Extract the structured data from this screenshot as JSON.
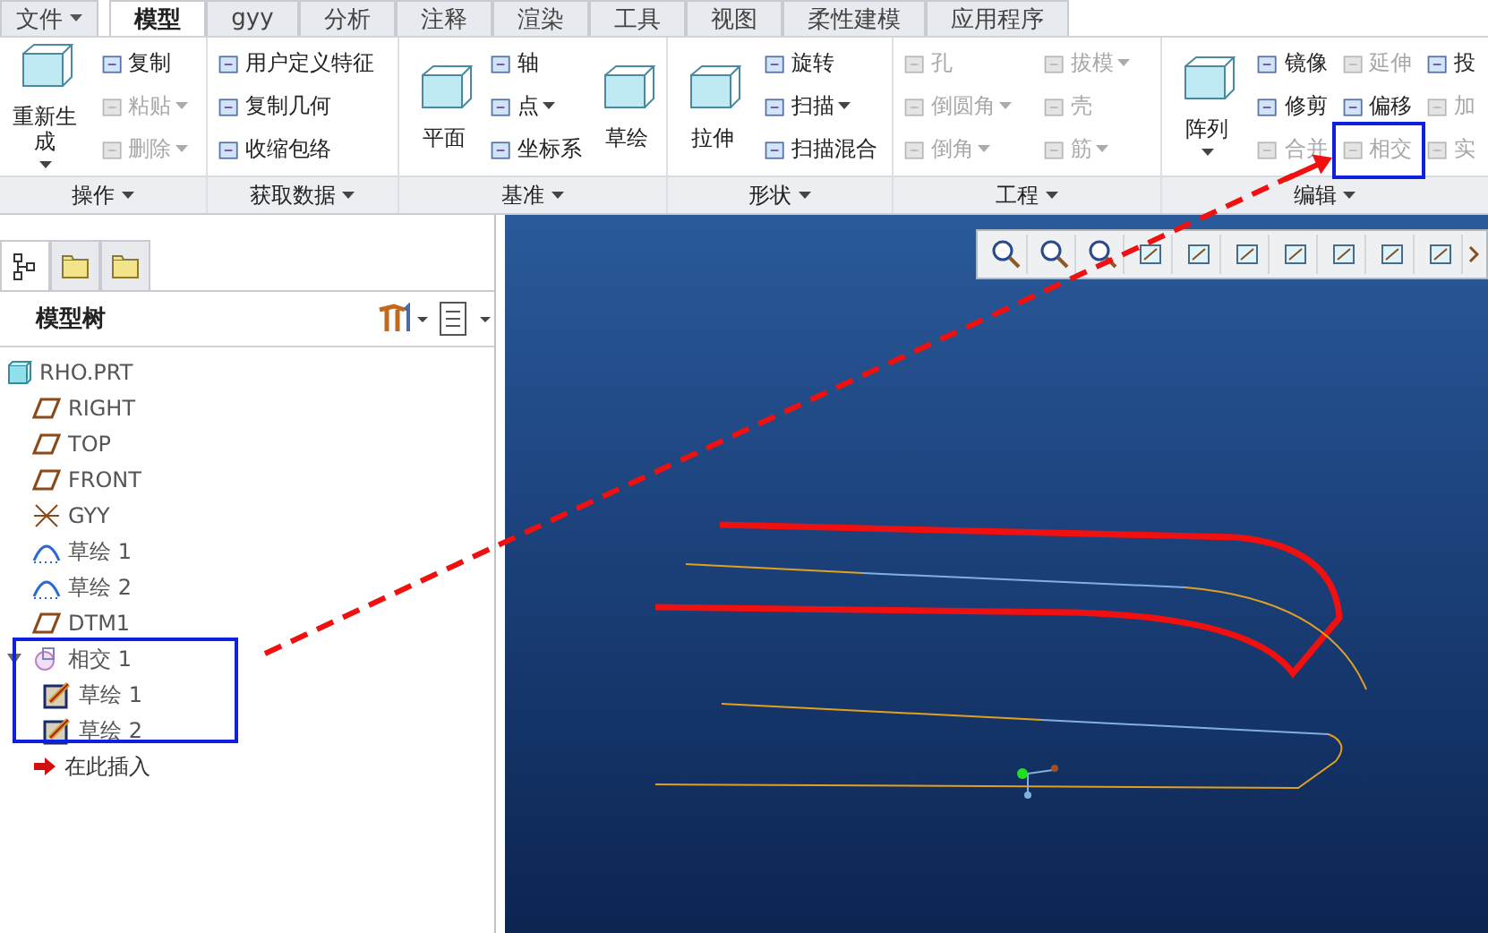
{
  "menu_tabs": [
    {
      "label": "文件",
      "kind": "file",
      "selected": false
    },
    {
      "label": "模型",
      "kind": "tab",
      "selected": true
    },
    {
      "label": "gyy",
      "kind": "tab",
      "selected": false
    },
    {
      "label": "分析",
      "kind": "tab",
      "selected": false
    },
    {
      "label": "注释",
      "kind": "tab",
      "selected": false
    },
    {
      "label": "渲染",
      "kind": "tab",
      "selected": false
    },
    {
      "label": "工具",
      "kind": "tab",
      "selected": false
    },
    {
      "label": "视图",
      "kind": "tab",
      "selected": false
    },
    {
      "label": "柔性建模",
      "kind": "tab",
      "selected": false
    },
    {
      "label": "应用程序",
      "kind": "tab",
      "selected": false
    }
  ],
  "ribbon_groups": [
    {
      "label": "操作",
      "items": [
        {
          "label": "重新生成",
          "kind": "large",
          "disabled": false,
          "dropdown": true
        },
        {
          "label": "复制",
          "kind": "small",
          "disabled": false,
          "dropdown": false
        },
        {
          "label": "粘贴",
          "kind": "small",
          "disabled": true,
          "dropdown": true
        },
        {
          "label": "删除",
          "kind": "small",
          "disabled": true,
          "dropdown": true
        }
      ]
    },
    {
      "label": "获取数据",
      "items": [
        {
          "label": "用户定义特征",
          "kind": "small",
          "disabled": false,
          "dropdown": false
        },
        {
          "label": "复制几何",
          "kind": "small",
          "disabled": false,
          "dropdown": false
        },
        {
          "label": "收缩包络",
          "kind": "small",
          "disabled": false,
          "dropdown": false
        }
      ]
    },
    {
      "label": "基准",
      "items": [
        {
          "label": "平面",
          "kind": "large",
          "disabled": false,
          "dropdown": false
        },
        {
          "label": "轴",
          "kind": "small",
          "disabled": false,
          "dropdown": false
        },
        {
          "label": "点",
          "kind": "small",
          "disabled": false,
          "dropdown": true
        },
        {
          "label": "坐标系",
          "kind": "small",
          "disabled": false,
          "dropdown": false
        },
        {
          "label": "草绘",
          "kind": "large",
          "disabled": false,
          "dropdown": false
        }
      ]
    },
    {
      "label": "形状",
      "items": [
        {
          "label": "拉伸",
          "kind": "large",
          "disabled": false,
          "dropdown": false
        },
        {
          "label": "旋转",
          "kind": "small",
          "disabled": false,
          "dropdown": false
        },
        {
          "label": "扫描",
          "kind": "small",
          "disabled": false,
          "dropdown": true
        },
        {
          "label": "扫描混合",
          "kind": "small",
          "disabled": false,
          "dropdown": false
        }
      ]
    },
    {
      "label": "工程",
      "items": [
        {
          "label": "孔",
          "kind": "small",
          "disabled": true,
          "dropdown": false
        },
        {
          "label": "倒圆角",
          "kind": "small",
          "disabled": true,
          "dropdown": true
        },
        {
          "label": "倒角",
          "kind": "small",
          "disabled": true,
          "dropdown": true
        },
        {
          "label": "拔模",
          "kind": "small",
          "disabled": true,
          "dropdown": true
        },
        {
          "label": "壳",
          "kind": "small",
          "disabled": true,
          "dropdown": false
        },
        {
          "label": "筋",
          "kind": "small",
          "disabled": true,
          "dropdown": true
        }
      ]
    },
    {
      "label": "编辑",
      "items": [
        {
          "label": "阵列",
          "kind": "large",
          "disabled": false,
          "dropdown": true
        },
        {
          "label": "镜像",
          "kind": "small",
          "disabled": false,
          "dropdown": false
        },
        {
          "label": "修剪",
          "kind": "small",
          "disabled": false,
          "dropdown": false
        },
        {
          "label": "合并",
          "kind": "small",
          "disabled": true,
          "dropdown": false
        },
        {
          "label": "延伸",
          "kind": "small",
          "disabled": true,
          "dropdown": false
        },
        {
          "label": "偏移",
          "kind": "small",
          "disabled": false,
          "dropdown": false
        },
        {
          "label": "相交",
          "kind": "small",
          "disabled": true,
          "dropdown": false
        },
        {
          "label": "投",
          "kind": "small",
          "disabled": false,
          "dropdown": false
        },
        {
          "label": "加",
          "kind": "small",
          "disabled": true,
          "dropdown": false
        },
        {
          "label": "实",
          "kind": "small",
          "disabled": true,
          "dropdown": false
        }
      ]
    }
  ],
  "navigator_tabs": [
    {
      "selected": true
    },
    {
      "selected": false
    },
    {
      "selected": false
    }
  ],
  "model_tree": {
    "title": "模型树",
    "items": [
      {
        "label": "RHO.PRT",
        "kind": "part"
      },
      {
        "label": "RIGHT",
        "kind": "plane"
      },
      {
        "label": "TOP",
        "kind": "plane"
      },
      {
        "label": "FRONT",
        "kind": "plane"
      },
      {
        "label": "GYY",
        "kind": "csys"
      },
      {
        "label": "草绘 1",
        "kind": "curve"
      },
      {
        "label": "草绘 2",
        "kind": "curve"
      },
      {
        "label": "DTM1",
        "kind": "plane"
      },
      {
        "label": "相交 1",
        "kind": "intersect",
        "expanded": true,
        "children": [
          {
            "label": "草绘 1",
            "kind": "sketch"
          },
          {
            "label": "草绘 2",
            "kind": "sketch"
          }
        ]
      },
      {
        "label": "在此插入",
        "kind": "insert"
      }
    ]
  }
}
